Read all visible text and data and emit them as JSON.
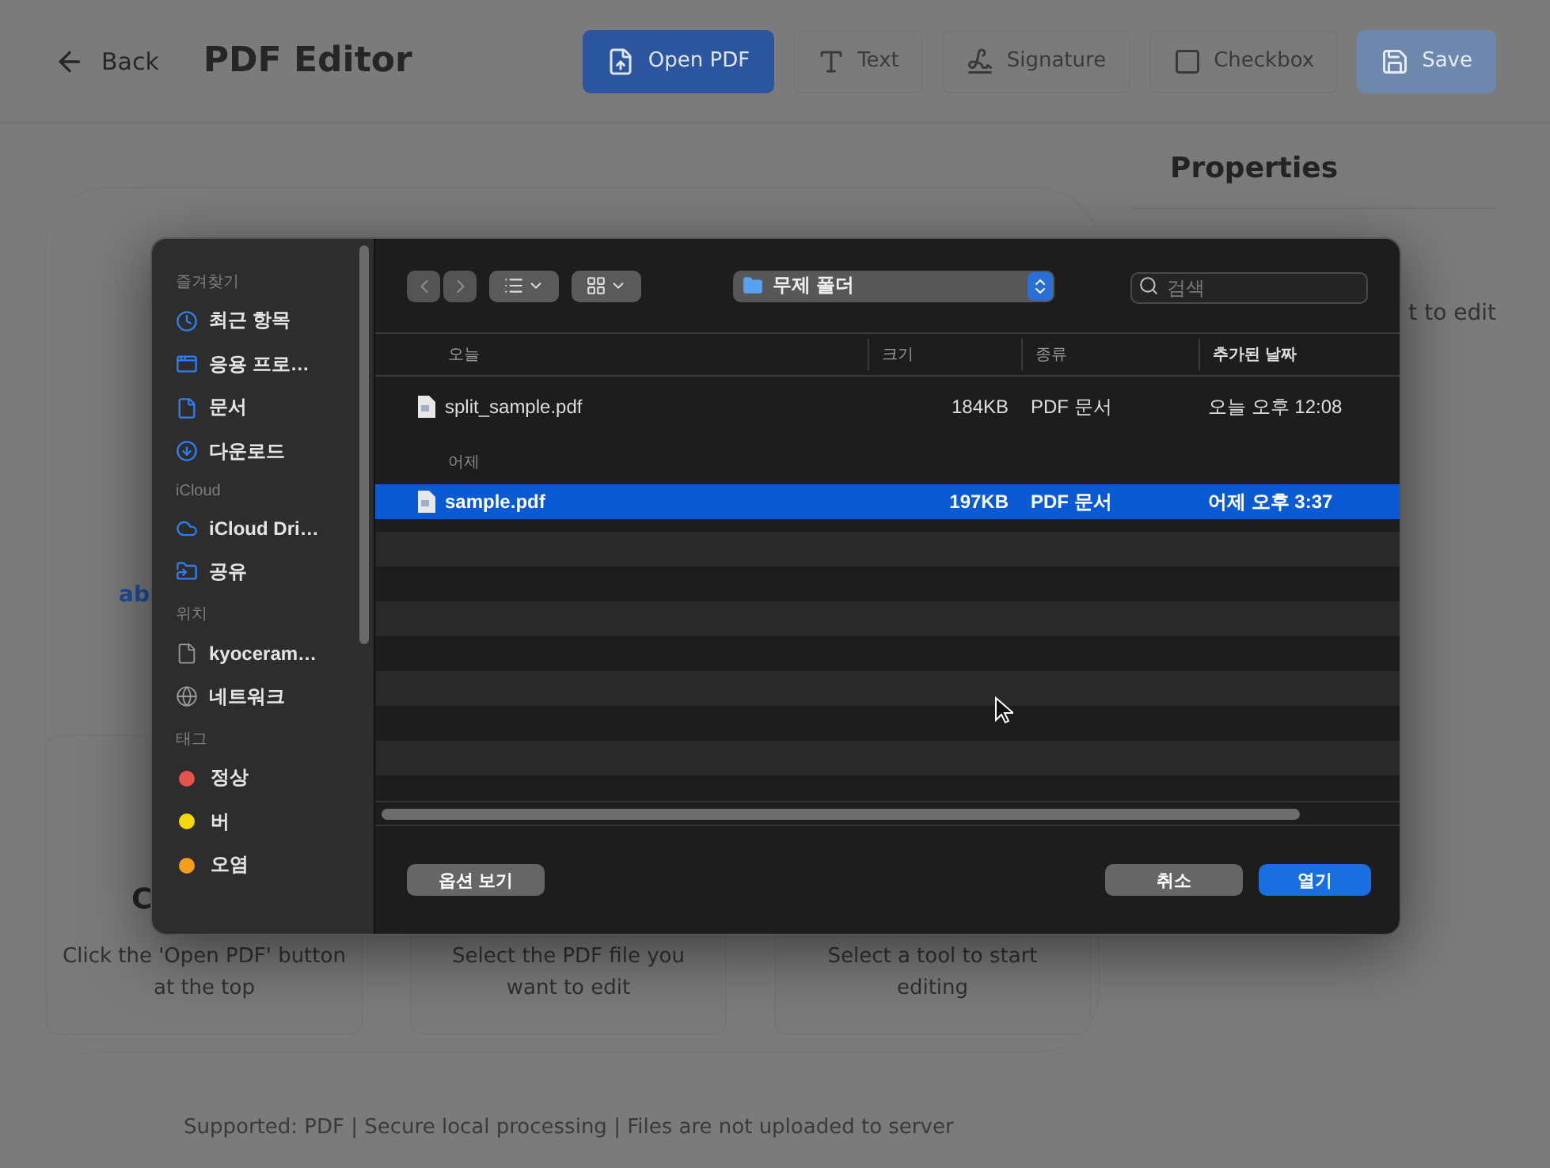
{
  "header": {
    "back": "Back",
    "title": "PDF Editor",
    "buttons": [
      {
        "label": "Open PDF",
        "kind": "open",
        "disabled": false
      },
      {
        "label": "Text",
        "kind": "text",
        "disabled": true
      },
      {
        "label": "Signature",
        "kind": "signature",
        "disabled": true
      },
      {
        "label": "Checkbox",
        "kind": "checkbox",
        "disabled": true
      },
      {
        "label": "Save",
        "kind": "save",
        "disabled": true
      }
    ]
  },
  "properties": {
    "title": "Properties",
    "hint": "t to edit"
  },
  "dropzone": {
    "fragment": "ab",
    "steps": [
      {
        "title": "C",
        "text": "Click the 'Open PDF' button at the top"
      },
      {
        "text": "Select the PDF file you want to edit"
      },
      {
        "text": "Select a tool to start editing"
      }
    ]
  },
  "footer": "Supported: PDF | Secure local processing | Files are not uploaded to server",
  "dialog": {
    "sidebar": [
      {
        "heading": "즐겨찾기",
        "items": [
          {
            "label": "최근 항목",
            "kind": "recent"
          },
          {
            "label": "응용 프로…",
            "kind": "apps"
          },
          {
            "label": "문서",
            "kind": "documents"
          },
          {
            "label": "다운로드",
            "kind": "downloads"
          }
        ]
      },
      {
        "heading": "iCloud",
        "items": [
          {
            "label": "iCloud Dri…",
            "kind": "icloud"
          },
          {
            "label": "공유",
            "kind": "shared"
          }
        ]
      },
      {
        "heading": "위치",
        "items": [
          {
            "label": "kyoceram…",
            "kind": "drive"
          },
          {
            "label": "네트워크",
            "kind": "network"
          }
        ]
      },
      {
        "heading": "태그",
        "items": [
          {
            "label": "정상",
            "kind": "tag",
            "color": "#e5534b"
          },
          {
            "label": "버",
            "kind": "tag",
            "color": "#f5d90a"
          },
          {
            "label": "오염",
            "kind": "tag",
            "color": "#f59e1b"
          }
        ]
      }
    ],
    "folder": "무제 폴더",
    "search": {
      "placeholder": "검색"
    },
    "columns": [
      "오늘",
      "크기",
      "종류",
      "추가된 날짜"
    ],
    "groups": [
      {
        "files": [
          {
            "name": "split_sample.pdf",
            "size": "184KB",
            "kind": "PDF 문서",
            "date": "오늘 오후 12:08",
            "selected": false
          }
        ]
      },
      {
        "label": "어제",
        "files": [
          {
            "name": "sample.pdf",
            "size": "197KB",
            "kind": "PDF 문서",
            "date": "어제 오후 3:37",
            "selected": true
          }
        ]
      }
    ],
    "buttons": {
      "options": "옵션 보기",
      "cancel": "취소",
      "open": "열기"
    }
  }
}
